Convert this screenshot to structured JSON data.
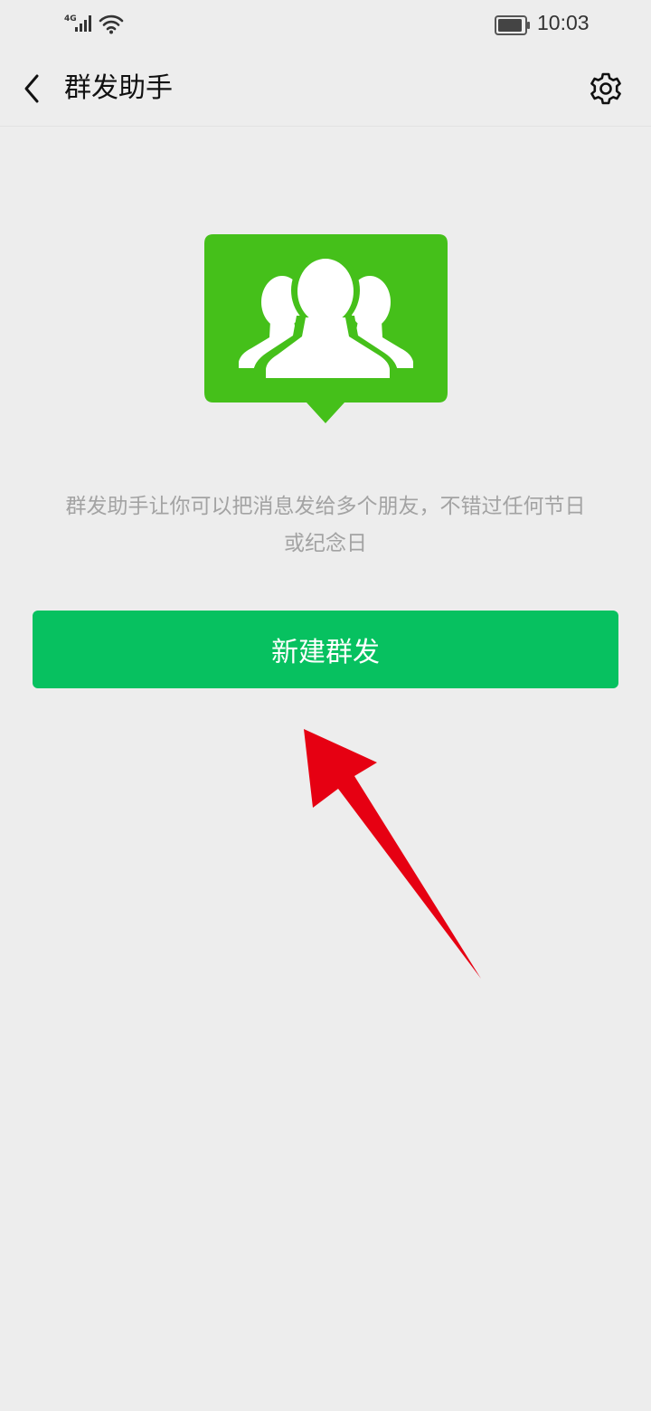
{
  "status_bar": {
    "network": "4G",
    "time": "10:03",
    "icons": [
      "signal-icon",
      "wifi-icon",
      "battery-icon"
    ]
  },
  "nav": {
    "title": "群发助手",
    "back_icon": "chevron-left-icon",
    "settings_icon": "gear-icon"
  },
  "hero": {
    "icon": "group-chat-icon",
    "color": "#45c01a"
  },
  "intro": {
    "line1": "群发助手让你可以把消息发给多个朋友，不错过任何节日",
    "line2": "或纪念日"
  },
  "primary_button": {
    "label": "新建群发",
    "color": "#07c160"
  },
  "annotation": {
    "icon": "red-arrow-icon",
    "color": "#e60012"
  }
}
